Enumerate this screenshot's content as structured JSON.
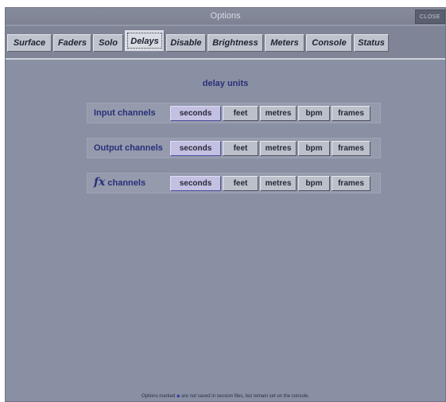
{
  "window": {
    "title": "Options",
    "close_label": "CLOSE"
  },
  "tabs": [
    {
      "label": "Surface"
    },
    {
      "label": "Faders"
    },
    {
      "label": "Solo"
    },
    {
      "label": "Delays"
    },
    {
      "label": "Disable"
    },
    {
      "label": "Brightness"
    },
    {
      "label": "Meters"
    },
    {
      "label": "Console"
    },
    {
      "label": "Status"
    }
  ],
  "active_tab": "Delays",
  "delay_units": {
    "title": "delay units",
    "units": [
      "seconds",
      "feet",
      "metres",
      "bpm",
      "frames"
    ],
    "rows": [
      {
        "label": "Input channels",
        "fx_symbol": "",
        "selected": "seconds"
      },
      {
        "label": "Output channels",
        "fx_symbol": "",
        "selected": "seconds"
      },
      {
        "label": "channels",
        "fx_symbol": "fx",
        "selected": "seconds"
      }
    ]
  },
  "footer": {
    "prefix": "Options marked",
    "marker": "◆",
    "suffix": "are not saved in session files, but remain set on the console."
  },
  "colors": {
    "window_bg": "#8a90a3",
    "label_text": "#27307a",
    "selected_unit": "#c4c0e2"
  }
}
